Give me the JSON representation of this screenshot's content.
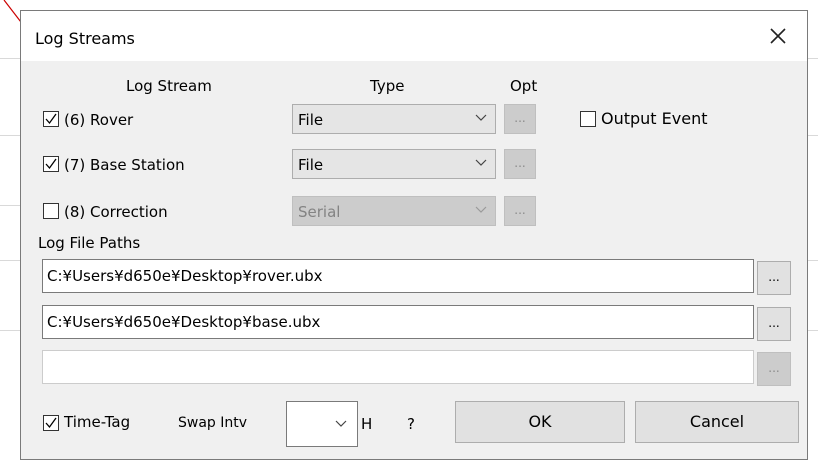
{
  "dialog": {
    "title": "Log Streams",
    "close_icon": "close-icon"
  },
  "headers": {
    "stream": "Log Stream",
    "type": "Type",
    "opt": "Opt"
  },
  "streams": [
    {
      "label": "(6) Rover",
      "checked": true,
      "type": "File",
      "enabled": true,
      "opt_label": "..."
    },
    {
      "label": "(7) Base Station",
      "checked": true,
      "type": "File",
      "enabled": true,
      "opt_label": "..."
    },
    {
      "label": "(8) Correction",
      "checked": false,
      "type": "Serial",
      "enabled": false,
      "opt_label": "..."
    }
  ],
  "output_event": {
    "label": "Output Event",
    "checked": false
  },
  "paths": {
    "label": "Log File Paths",
    "items": [
      {
        "value": "C:¥Users¥d650e¥Desktop¥rover.ubx",
        "button": "...",
        "enabled": true
      },
      {
        "value": "C:¥Users¥d650e¥Desktop¥base.ubx",
        "button": "...",
        "enabled": true
      },
      {
        "value": "",
        "button": "...",
        "enabled": false
      }
    ]
  },
  "footer": {
    "time_tag_label": "Time-Tag",
    "time_tag_checked": true,
    "swap_label": "Swap Intv",
    "swap_value": "",
    "unit": "H",
    "help": "?",
    "ok": "OK",
    "cancel": "Cancel"
  },
  "colors": {
    "dialog_bg": "#f0f0f0",
    "titlebar_bg": "#ffffff",
    "button_bg": "#e1e1e1",
    "disabled_bg": "#cccccc",
    "annotation_line": "#cc0000"
  }
}
